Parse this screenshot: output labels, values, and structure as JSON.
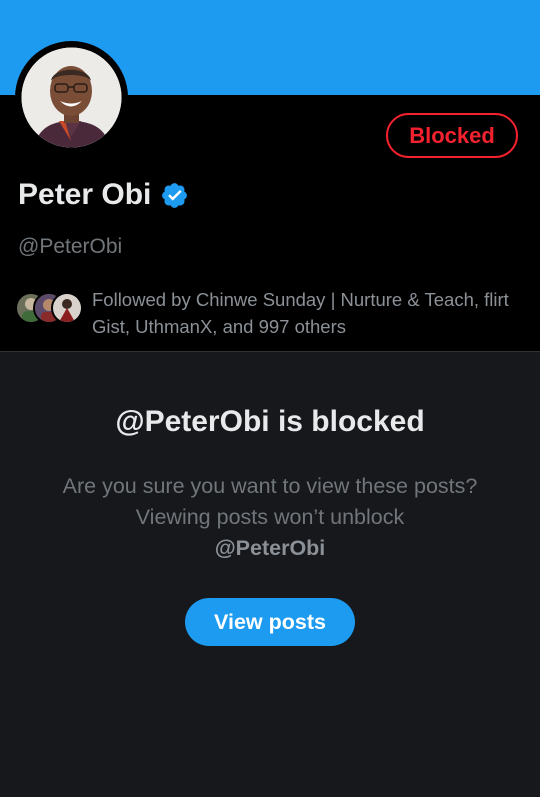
{
  "profile": {
    "display_name": "Peter Obi",
    "handle": "@PeterObi",
    "blocked_label": "Blocked",
    "verified_icon": "verified-badge-icon",
    "followed_by": "Followed by Chinwe Sunday | Nurture & Teach, flirt Gist, UthmanX, and 997 others"
  },
  "blocked_notice": {
    "title": "@PeterObi is blocked",
    "message": "Are you sure you want to view these posts? Viewing posts won’t unblock",
    "handle": "@PeterObi",
    "view_posts_label": "View posts"
  },
  "colors": {
    "banner": "#1d9bf0",
    "accent": "#1d9bf0",
    "blocked_red": "#f4212e",
    "header_bg": "#000000",
    "notice_bg": "#16181c"
  }
}
